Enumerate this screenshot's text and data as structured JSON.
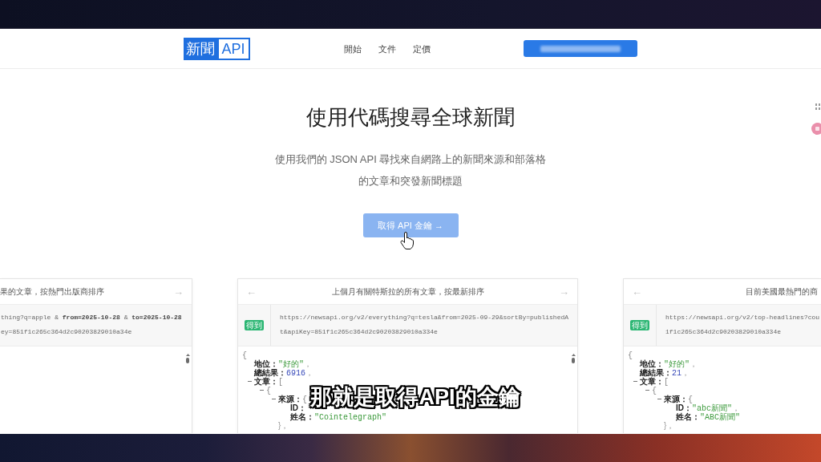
{
  "frame": {
    "caption": "那就是取得API的金鑰"
  },
  "header": {
    "logo": {
      "part_1": "新聞",
      "part_2": "API"
    },
    "nav": [
      {
        "label": "開始"
      },
      {
        "label": "文件"
      },
      {
        "label": "定價"
      }
    ],
    "cta": {
      "redacted": true
    }
  },
  "hero": {
    "title": "使用代碼搜尋全球新聞",
    "subtitle": "使用我們的 JSON API 尋找來自網路上的新聞來源和部落格的文章和突發新聞標題",
    "button": "取得 API 金鑰 →"
  },
  "examples": [
    {
      "title": "果的文章，按熱門出版商排序",
      "next": "→",
      "url_lines": [
        "thing?q=apple & **from=2025-10-28** & **to=2025-10-28**",
        "ey=851f1c265c364d2c90203829010a34e"
      ]
    },
    {
      "prev": "←",
      "title": "上個月有關特斯拉的所有文章，按最新排序",
      "next": "→",
      "badge": "得到",
      "url_lines": [
        "https://newsapi.org/v2/everything?q=tesla&from=2025-09-29&sortBy=publishedA",
        "t&apiKey=851f1c265c364d2c90203829010a334e"
      ],
      "response": {
        "value": "{",
        "kind": "bracket",
        "children": [
          {
            "key": "地位：",
            "value": "\"好的\"",
            "kind": "string",
            "after": "，"
          },
          {
            "key": "總結果：",
            "value": "6916",
            "kind": "number",
            "after": "，"
          },
          {
            "key": "文章：",
            "value": "[",
            "kind": "bracket",
            "expanded": true,
            "children": [
              {
                "value": "{",
                "kind": "bracket",
                "expanded": true,
                "children": [
                  {
                    "key": "來源：",
                    "value": "{",
                    "kind": "bracket",
                    "expanded": true,
                    "children": [
                      {
                        "key": "ID："
                      },
                      {
                        "key": "姓名：",
                        "value": "\"Cointelegraph\"",
                        "kind": "string"
                      }
                    ],
                    "close": "}，"
                  }
                ]
              }
            ]
          }
        ]
      }
    },
    {
      "prev": "←",
      "title": "目前美國最熱門的商",
      "badge": "得到",
      "url_lines": [
        "https://newsapi.org/v2/top-headlines?cou",
        "1f1c265c364d2c90203829010a334e"
      ],
      "response": {
        "value": "{",
        "kind": "bracket",
        "children": [
          {
            "key": "地位：",
            "value": "\"好的\"",
            "kind": "string",
            "after": "，"
          },
          {
            "key": "總結果：",
            "value": "21",
            "kind": "number",
            "after": "，"
          },
          {
            "key": "文章：",
            "value": "[",
            "kind": "bracket",
            "expanded": true,
            "children": [
              {
                "value": "{",
                "kind": "bracket",
                "expanded": true,
                "children": [
                  {
                    "key": "來源：",
                    "value": "{",
                    "kind": "bracket",
                    "expanded": true,
                    "children": [
                      {
                        "key": "ID：",
                        "value": "\"abc新聞\"",
                        "kind": "string",
                        "after": "，"
                      },
                      {
                        "key": "姓名：",
                        "value": "\"ABC新聞\"",
                        "kind": "string"
                      }
                    ],
                    "close": "}，"
                  }
                ]
              }
            ]
          }
        ]
      }
    }
  ]
}
